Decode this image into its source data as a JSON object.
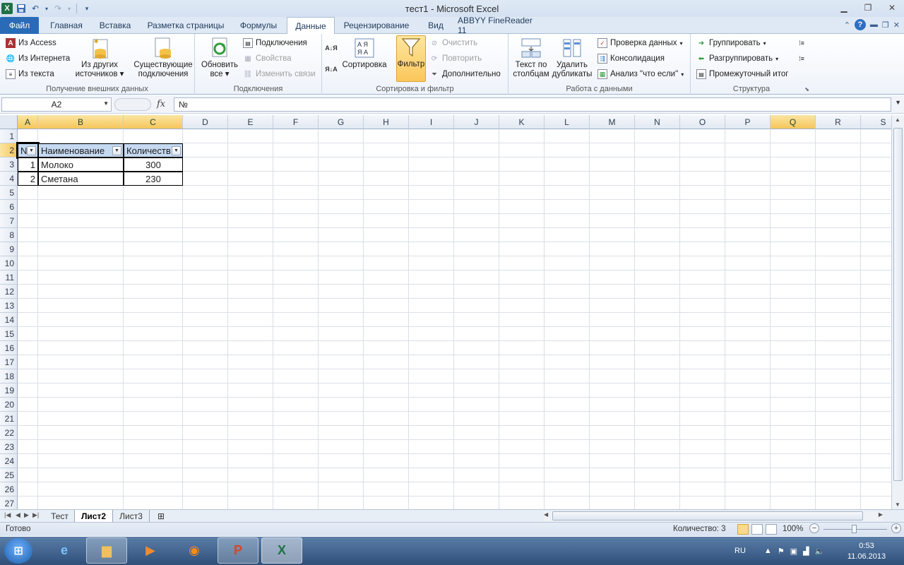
{
  "window": {
    "title": "тест1  -  Microsoft Excel"
  },
  "tabs": {
    "file": "Файл",
    "items": [
      "Главная",
      "Вставка",
      "Разметка страницы",
      "Формулы",
      "Данные",
      "Рецензирование",
      "Вид",
      "ABBYY FineReader 11"
    ],
    "active": "Данные"
  },
  "ribbon": {
    "external": {
      "label": "Получение внешних данных",
      "from_access": "Из Access",
      "from_web": "Из Интернета",
      "from_text": "Из текста",
      "from_other_l1": "Из других",
      "from_other_l2": "источников",
      "existing_l1": "Существующие",
      "existing_l2": "подключения"
    },
    "connections": {
      "label": "Подключения",
      "refresh_l1": "Обновить",
      "refresh_l2": "все",
      "connections": "Подключения",
      "properties": "Свойства",
      "edit_links": "Изменить связи"
    },
    "sortfilter": {
      "label": "Сортировка и фильтр",
      "sort": "Сортировка",
      "filter": "Фильтр",
      "clear": "Очистить",
      "reapply": "Повторить",
      "advanced": "Дополнительно"
    },
    "datatools": {
      "label": "Работа с данными",
      "text_to_cols_l1": "Текст по",
      "text_to_cols_l2": "столбцам",
      "remove_dup_l1": "Удалить",
      "remove_dup_l2": "дубликаты",
      "validation": "Проверка данных",
      "consolidate": "Консолидация",
      "whatif": "Анализ \"что если\""
    },
    "outline": {
      "label": "Структура",
      "group": "Группировать",
      "ungroup": "Разгруппировать",
      "subtotal": "Промежуточный итог"
    }
  },
  "formula_bar": {
    "name_box": "A2",
    "fx": "fx",
    "formula": "№"
  },
  "grid": {
    "columns": [
      "A",
      "B",
      "C",
      "D",
      "E",
      "F",
      "G",
      "H",
      "I",
      "J",
      "K",
      "L",
      "M",
      "N",
      "O",
      "P",
      "Q",
      "R",
      "S"
    ],
    "selected_columns": [
      "A",
      "B",
      "C",
      "Q"
    ],
    "rows": [
      "1",
      "2",
      "3",
      "4",
      "5",
      "6",
      "7",
      "8",
      "9",
      "10",
      "11",
      "12",
      "13",
      "14",
      "15",
      "16",
      "17",
      "18",
      "19",
      "20",
      "21",
      "22",
      "23",
      "24",
      "25",
      "26",
      "27"
    ],
    "selected_row": "2"
  },
  "table": {
    "headers": [
      "№",
      "Наименование",
      "Количество"
    ],
    "header_display": [
      "N",
      "Наименование",
      "Количеств"
    ],
    "rows": [
      [
        "1",
        "Молоко",
        "300"
      ],
      [
        "2",
        "Сметана",
        "230"
      ]
    ]
  },
  "sheets": {
    "items": [
      "Тест",
      "Лист2",
      "Лист3"
    ],
    "active": "Лист2"
  },
  "status": {
    "ready": "Готово",
    "count": "Количество: 3",
    "zoom": "100%"
  },
  "taskbar": {
    "lang": "RU",
    "time": "0:53",
    "date": "11.06.2013"
  },
  "colors": {
    "table_header_bg": "#c5d9f1",
    "file_tab_bg": "#2a6bb7",
    "active_filter_bg": "#fbc65a"
  }
}
